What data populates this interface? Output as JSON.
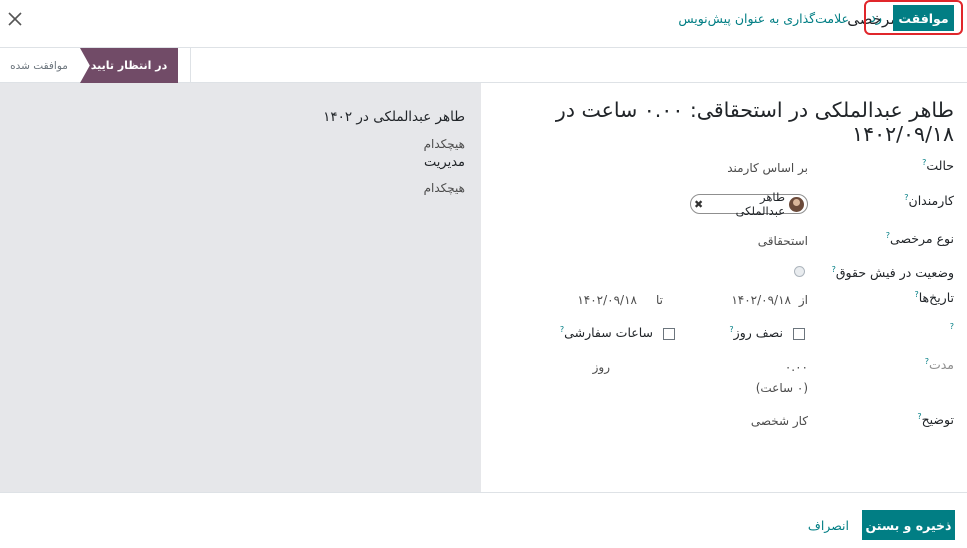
{
  "modal": {
    "title": "باز کنید: مرخصی"
  },
  "statusbar": {
    "approve_label": "موافقت",
    "refuse_label": "رد",
    "draft_label": "علامت‌گذاری به عنوان پیش‌نویس",
    "stages": [
      {
        "label": "موافقت شده",
        "active": false
      },
      {
        "label": "در انتظار تایید",
        "active": true
      }
    ]
  },
  "form": {
    "title": "طاهر عبدالملکی در استحقاقی: ۰.۰۰ ساعت در ۱۴۰۲/۰۹/۱۸",
    "fields": {
      "mode": {
        "label": "حالت",
        "value": "بر اساس کارمند"
      },
      "employees": {
        "label": "کارمندان",
        "tag": "طاهر عبدالملکی"
      },
      "leave_type": {
        "label": "نوع مرخصی",
        "value": "استحقاقی"
      },
      "payslip_status": {
        "label": "وضعیت در فیش حقوق"
      },
      "dates": {
        "label": "تاریخ‌ها",
        "from_label": "از",
        "from": "۱۴۰۲/۰۹/۱۸",
        "to_label": "تا",
        "to": "۱۴۰۲/۰۹/۱۸"
      },
      "half_day": {
        "label": "نصف روز"
      },
      "custom_hours": {
        "label": "ساعات سفارشی"
      },
      "duration": {
        "label": "مدت",
        "days": "۰.۰۰",
        "unit": "روز",
        "hours": "(۰ ساعت)"
      },
      "description": {
        "label": "توضیح",
        "value": "کار شخصی"
      }
    }
  },
  "side_panel": {
    "title": "طاهر عبدالملکی در ۱۴۰۲",
    "line1": "هیچکدام",
    "line2": "مدیریت",
    "line3": "هیچکدام"
  },
  "footer": {
    "save_label": "ذخیره و بستن",
    "discard_label": "انصراف"
  },
  "colors": {
    "primary": "#017e84",
    "stage_active": "#714b67",
    "highlight": "#e0262b",
    "side_panel": "#e6e7ea"
  }
}
